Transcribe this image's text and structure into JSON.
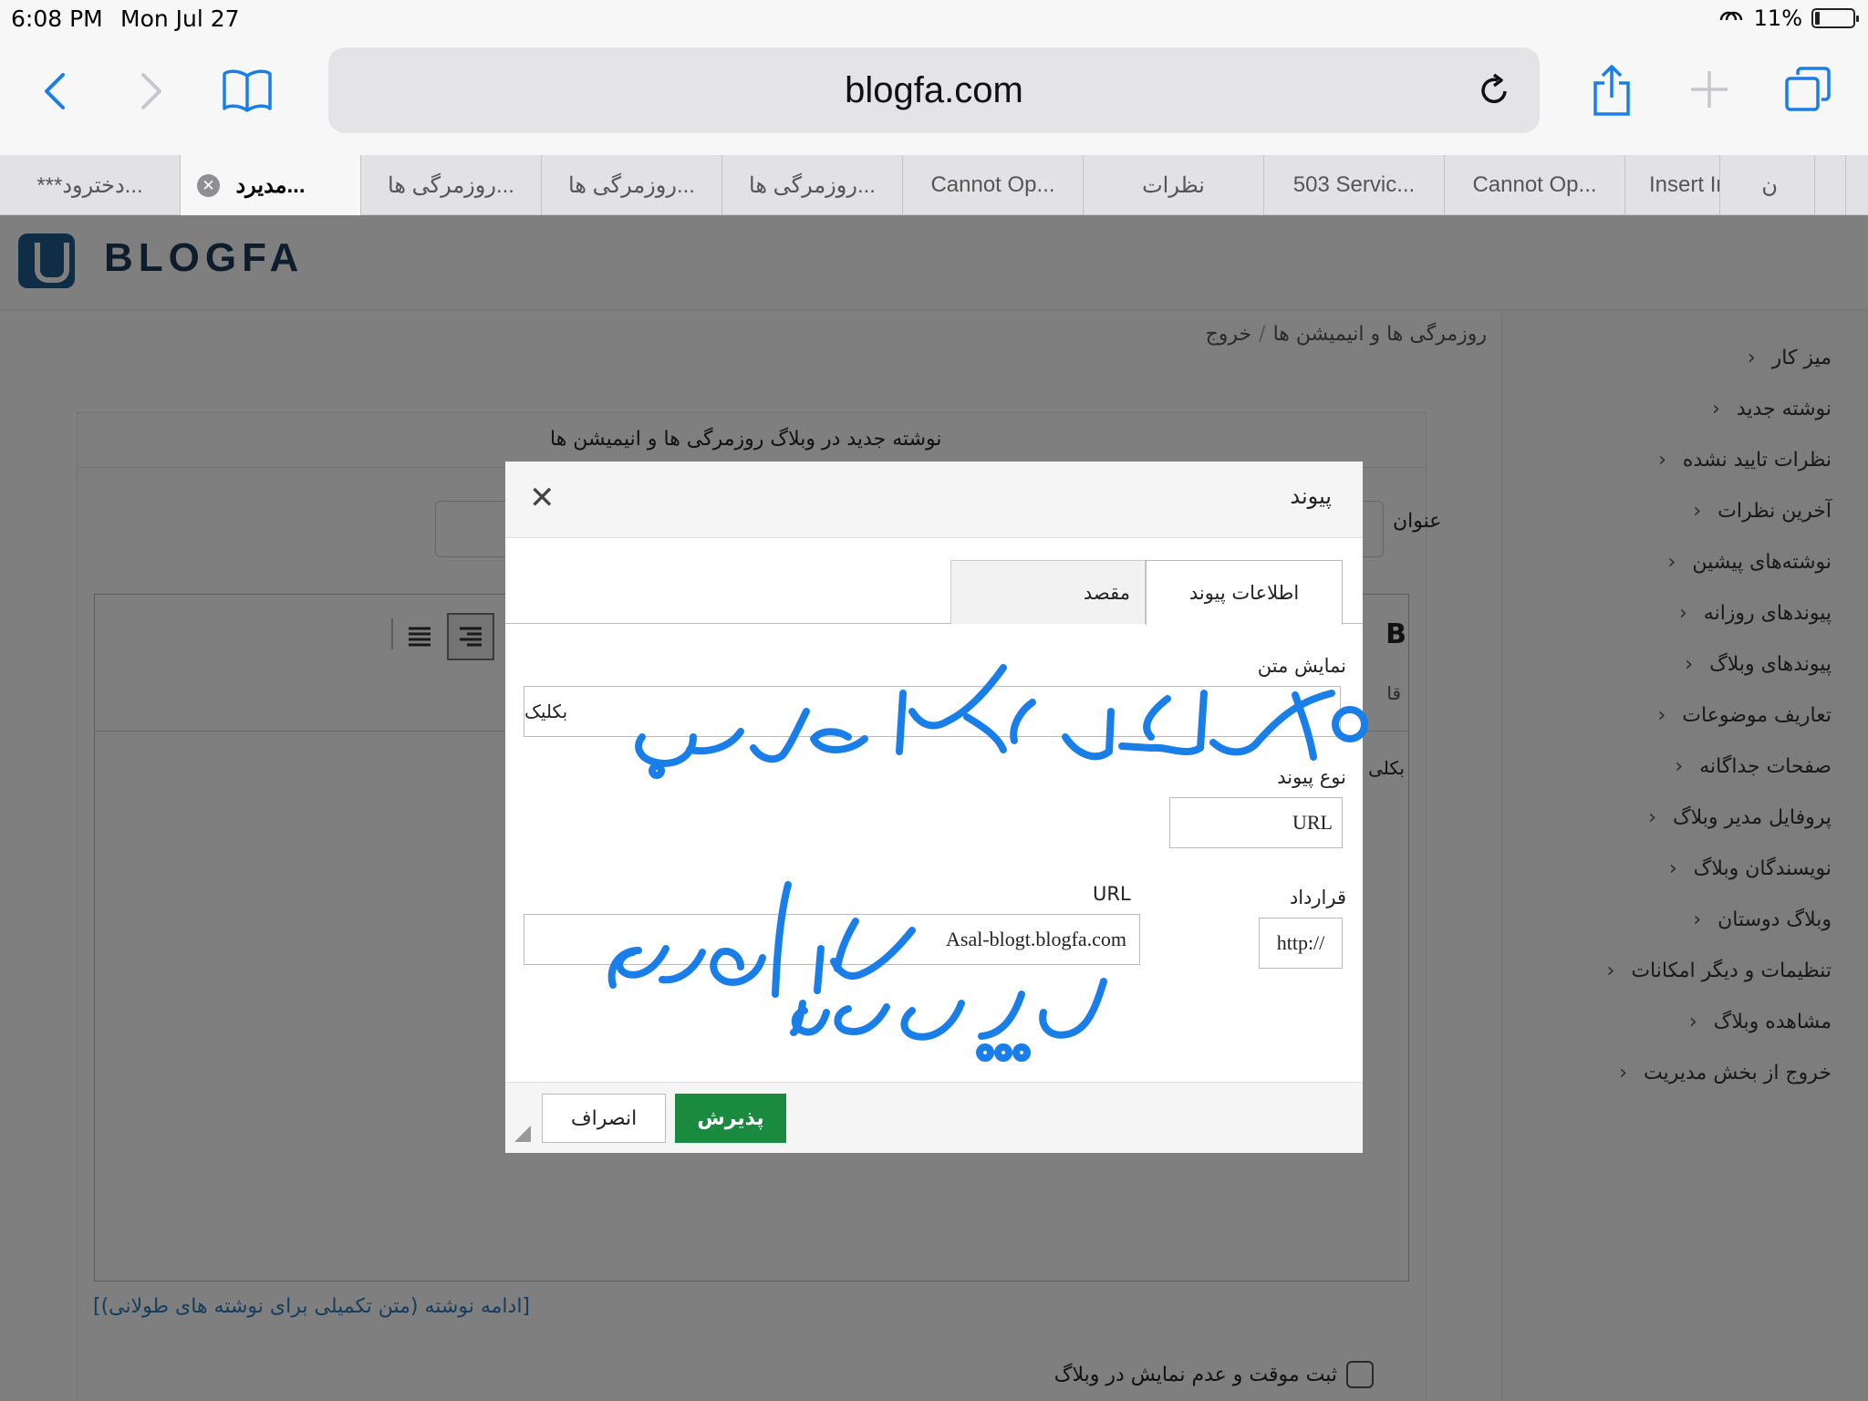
{
  "status_bar": {
    "time": "6:08 PM",
    "date": "Mon Jul 27",
    "battery_percent": "11%"
  },
  "browser": {
    "address": "blogfa.com",
    "tabs": [
      {
        "title": "***دخترود...",
        "active": false
      },
      {
        "title": "مدیرد...",
        "active": true
      },
      {
        "title": "روزمرگی ها...",
        "active": false
      },
      {
        "title": "روزمرگی ها...",
        "active": false
      },
      {
        "title": "روزمرگی ها...",
        "active": false
      },
      {
        "title": "Cannot Op...",
        "active": false
      },
      {
        "title": "نظرات",
        "active": false
      },
      {
        "title": "503 Servic...",
        "active": false
      },
      {
        "title": "Cannot Op...",
        "active": false
      },
      {
        "title": "Insert Im",
        "active": false
      },
      {
        "title": "ن",
        "active": false
      }
    ]
  },
  "site": {
    "logo_text": "BLOGFA",
    "breadcrumb": {
      "blog": "روزمرگی ها و انیمیشن ها",
      "logout": "خروج"
    },
    "sidebar": [
      "میز کار",
      "نوشته جدید",
      "نظرات تایید نشده",
      "آخرین نظرات",
      "نوشته‌های پیشین",
      "پیوندهای روزانه",
      "پیوندهای وبلاگ",
      "تعاریف موضوعات",
      "صفحات جداگانه",
      "پروفایل مدیر وبلاگ",
      "نویسندگان وبلاگ",
      "وبلاگ دوستان",
      "تنظیمات و دیگر امکانات",
      "مشاهده وبلاگ",
      "خروج از بخش مدیریت"
    ],
    "panel_title": "نوشته جدید در وبلاگ روزمرگی ها و انیمیشن ها",
    "title_label": "عنوان",
    "editor_peek": "بکلی",
    "more_link": "[ادامه نوشته (متن تکمیلی برای نوشته های طولانی)]",
    "draft_checkbox_label": "ثبت موقت و عدم نمایش در وبلاگ"
  },
  "modal": {
    "title": "پیوند",
    "close_glyph": "✕",
    "tabs": {
      "info": "اطلاعات پیوند",
      "target": "مقصد"
    },
    "display_text_label": "نمایش متن",
    "display_text_value": "بکلیک",
    "link_type_label": "نوع پیوند",
    "link_type_value": "URL",
    "protocol_label": "قرارداد",
    "protocol_value": "http://",
    "url_label": "URL",
    "url_value": "Asal-blogt.blogfa.com",
    "ok_label": "پذیرش",
    "cancel_label": "انصراف"
  },
  "colors": {
    "accent_blue": "#1a7ee8",
    "ok_green": "#1a8b3e",
    "link_blue": "#2a7ab8"
  }
}
